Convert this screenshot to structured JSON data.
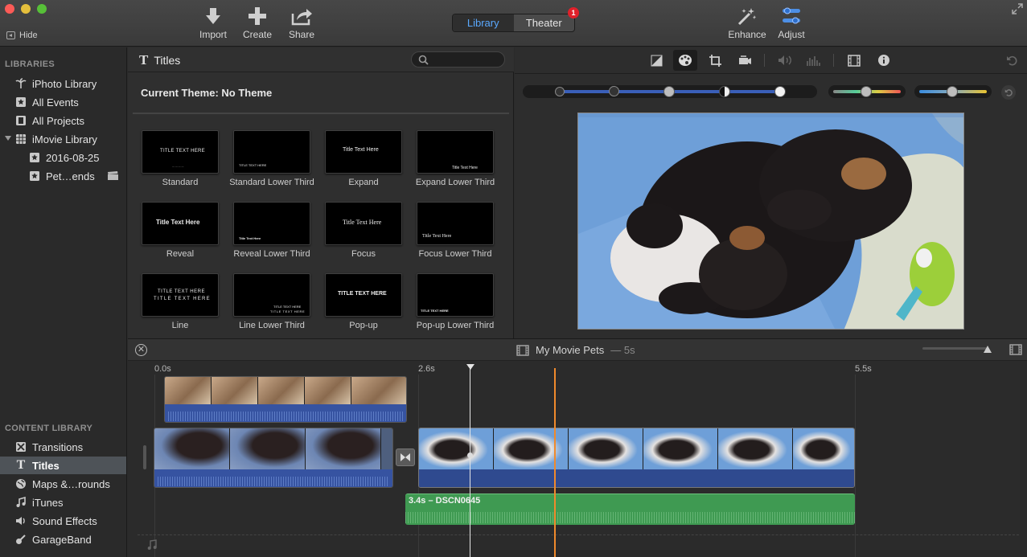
{
  "toolbar": {
    "hide_label": "Hide",
    "import_label": "Import",
    "create_label": "Create",
    "share_label": "Share",
    "library_tab": "Library",
    "theater_tab": "Theater",
    "theater_badge": "1",
    "enhance_label": "Enhance",
    "adjust_label": "Adjust"
  },
  "sidebar": {
    "libraries_header": "LIBRARIES",
    "libraries": [
      {
        "label": "iPhoto Library",
        "icon": "palm-tree-icon"
      },
      {
        "label": "All Events",
        "icon": "star-icon"
      },
      {
        "label": "All Projects",
        "icon": "film-icon"
      },
      {
        "label": "iMovie Library",
        "icon": "grid-icon"
      },
      {
        "label": "2016-08-25",
        "icon": "star-icon"
      },
      {
        "label": "Pet…ends",
        "icon": "star-icon"
      }
    ],
    "content_header": "CONTENT LIBRARY",
    "content": [
      {
        "label": "Transitions",
        "icon": "transitions-icon"
      },
      {
        "label": "Titles",
        "icon": "titles-icon",
        "selected": true
      },
      {
        "label": "Maps &…rounds",
        "icon": "globe-icon"
      },
      {
        "label": "iTunes",
        "icon": "music-note-icon"
      },
      {
        "label": "Sound Effects",
        "icon": "speaker-icon"
      },
      {
        "label": "GarageBand",
        "icon": "guitar-icon"
      }
    ]
  },
  "browser": {
    "title": "Titles",
    "theme": "Current Theme: No Theme",
    "tiles": [
      {
        "label": "Standard",
        "thumb": "TITLE TEXT HERE"
      },
      {
        "label": "Standard Lower Third",
        "thumb": "TITLE TEXT HERE"
      },
      {
        "label": "Expand",
        "thumb": "Title Text Here"
      },
      {
        "label": "Expand Lower Third",
        "thumb": "Title Text Here"
      },
      {
        "label": "Reveal",
        "thumb": "Title Text Here"
      },
      {
        "label": "Reveal Lower Third",
        "thumb": "Title Text Here"
      },
      {
        "label": "Focus",
        "thumb": "Title Text Here"
      },
      {
        "label": "Focus Lower Third",
        "thumb": "Title Text Here"
      },
      {
        "label": "Line",
        "thumb": "TITLE TEXT HERE"
      },
      {
        "label": "Line Lower Third",
        "thumb": "TITLE TEXT HERE"
      },
      {
        "label": "Pop-up",
        "thumb": "TITLE TEXT HERE"
      },
      {
        "label": "Pop-up Lower Third",
        "thumb": "TITLE TEXT HERE"
      }
    ]
  },
  "timeline": {
    "project_name": "My Movie Pets",
    "duration": "— 5s",
    "time_labels": [
      "0.0s",
      "2.6s",
      "5.5s"
    ],
    "audio_clip_label": "3.4s – DSCN0645"
  },
  "colors": {
    "accent": "#5aa9ff",
    "playhead": "#e5e5e5",
    "skimmer": "#f08a2c",
    "audio_clip": "#3f9a52",
    "video_audio": "#3653a1"
  }
}
